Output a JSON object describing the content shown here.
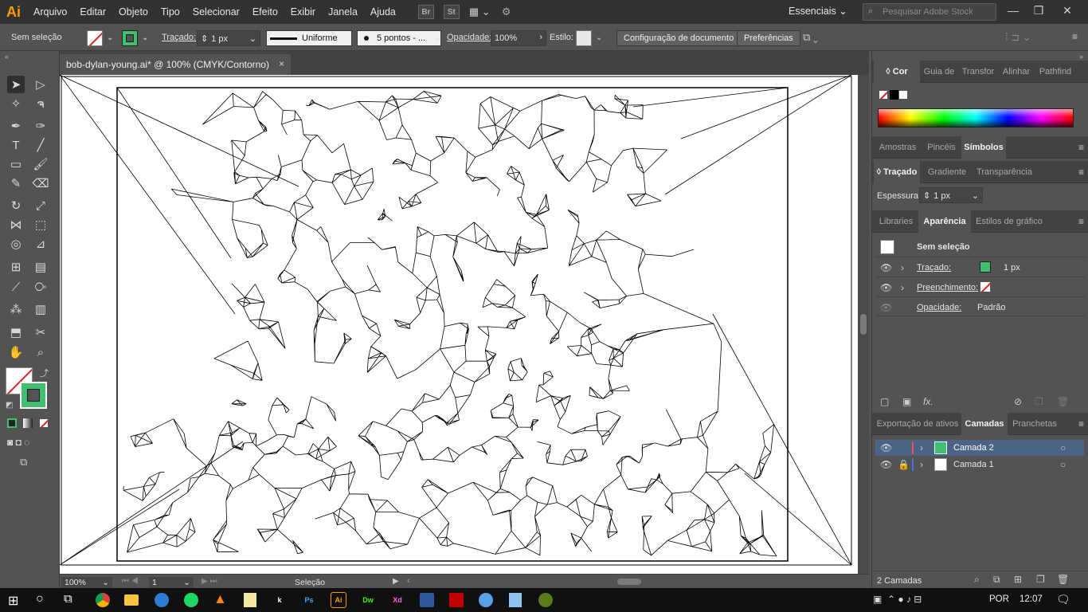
{
  "menubar": {
    "logo": "Ai",
    "items": [
      "Arquivo",
      "Editar",
      "Objeto",
      "Tipo",
      "Selecionar",
      "Efeito",
      "Exibir",
      "Janela",
      "Ajuda"
    ],
    "bridge_label": "Br",
    "stock_label": "St",
    "workspace": "Essenciais",
    "search_placeholder": "Pesquisar Adobe Stock",
    "accent_color": "#ff9a00"
  },
  "controlbar": {
    "selection_label": "Sem seleção",
    "stroke_label": "Traçado:",
    "stroke_weight": "1 px",
    "profile_label": "Uniforme",
    "brush_label": "5 pontos - ...",
    "opacity_label": "Opacidade:",
    "opacity_value": "100%",
    "style_label": "Estilo:",
    "doc_setup_button": "Configuração de documento",
    "prefs_button": "Preferências"
  },
  "document": {
    "tab_title": "bob-dylan-young.ai* @ 100% (CMYK/Contorno)",
    "close_glyph": "×"
  },
  "statusbar": {
    "zoom": "100%",
    "artboard": "1",
    "tool_status": "Seleção"
  },
  "panels": {
    "color_tabs": [
      "Cor",
      "Guia de",
      "Transfor",
      "Alinhar",
      "Pathfind"
    ],
    "swatch_tabs": [
      "Amostras",
      "Pincéis",
      "Símbolos"
    ],
    "stroke_tabs": [
      "Traçado",
      "Gradiente",
      "Transparência"
    ],
    "stroke_weight_label": "Espessura:",
    "stroke_weight_value": "1 px",
    "appearance_tabs": [
      "Libraries",
      "Aparência",
      "Estilos de gráfico"
    ],
    "appearance": {
      "header": "Sem seleção",
      "stroke_label": "Traçado:",
      "stroke_value": "1 px",
      "fill_label": "Preenchimento:",
      "opacity_label": "Opacidade:",
      "opacity_value": "Padrão",
      "fx_label": "fx."
    },
    "layer_tabs": [
      "Exportação de ativos",
      "Camadas",
      "Pranchetas"
    ],
    "layers": [
      {
        "name": "Camada 2",
        "color": "#ff4a4a",
        "selected": true
      },
      {
        "name": "Camada 1",
        "color": "#4a6dff",
        "selected": false
      }
    ],
    "layers_count": "2 Camadas",
    "stroke_color": "#3fbf6f"
  },
  "taskbar": {
    "tray_lang": "POR",
    "clock": "12:07"
  },
  "taskbar_apps": [
    {
      "name": "k",
      "color": "#1b6ac9"
    },
    {
      "name": "Ps",
      "color": "#0c2a3f"
    },
    {
      "name": "Ai",
      "color": "#3a1f00"
    },
    {
      "name": "Dw",
      "color": "#0b2e11"
    },
    {
      "name": "Xd",
      "color": "#2e0a25"
    }
  ]
}
